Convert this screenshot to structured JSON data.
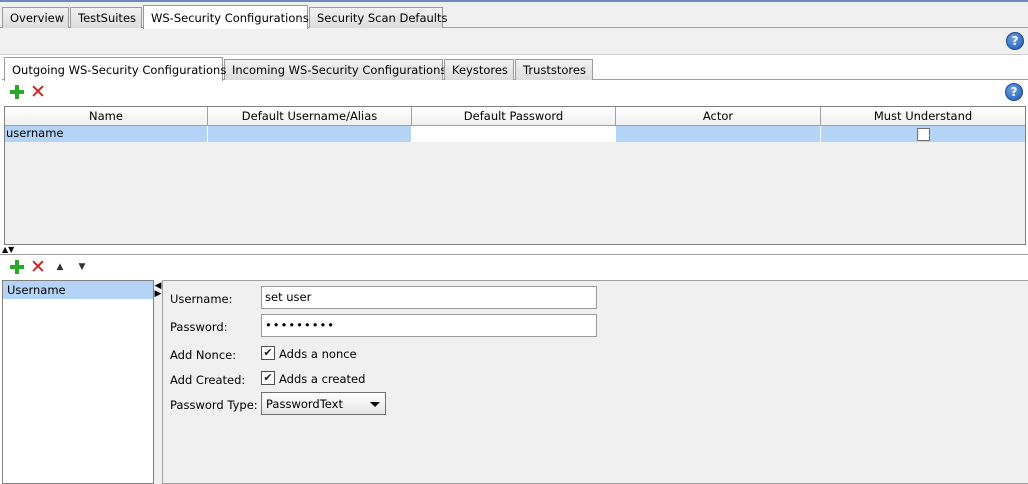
{
  "top_tabs": [
    "Overview",
    "TestSuites",
    "WS-Security Configurations",
    "Security Scan Defaults"
  ],
  "inner_tabs": [
    "Outgoing WS-Security Configurations",
    "Incoming WS-Security Configurations",
    "Keystores",
    "Truststores"
  ],
  "help_glyph": "?",
  "table": {
    "columns": [
      "Name",
      "Default Username/Alias",
      "Default Password",
      "Actor",
      "Must Understand"
    ],
    "rows": [
      {
        "name": "username",
        "alias": "",
        "password": "",
        "actor": "",
        "must_understand": false
      }
    ]
  },
  "entries": {
    "items": [
      "Username"
    ]
  },
  "form": {
    "username_label": "Username:",
    "username_value": "set user",
    "password_label": "Password:",
    "password_value": "•••••••••",
    "nonce_label": "Add Nonce:",
    "nonce_checkbox_text": "Adds a nonce",
    "nonce_checked": true,
    "created_label": "Add Created:",
    "created_checkbox_text": "Adds a created",
    "created_checked": true,
    "password_type_label": "Password Type:",
    "password_type_value": "PasswordText"
  },
  "icons": {
    "add": "plus-icon",
    "remove": "delete-icon",
    "move_up": "chevron-up-icon",
    "move_down": "chevron-down-icon",
    "help": "help-icon"
  },
  "colors": {
    "selected_row": "#b3d4f7",
    "add_green": "#2aa82a",
    "remove_red": "#d61a1a"
  }
}
